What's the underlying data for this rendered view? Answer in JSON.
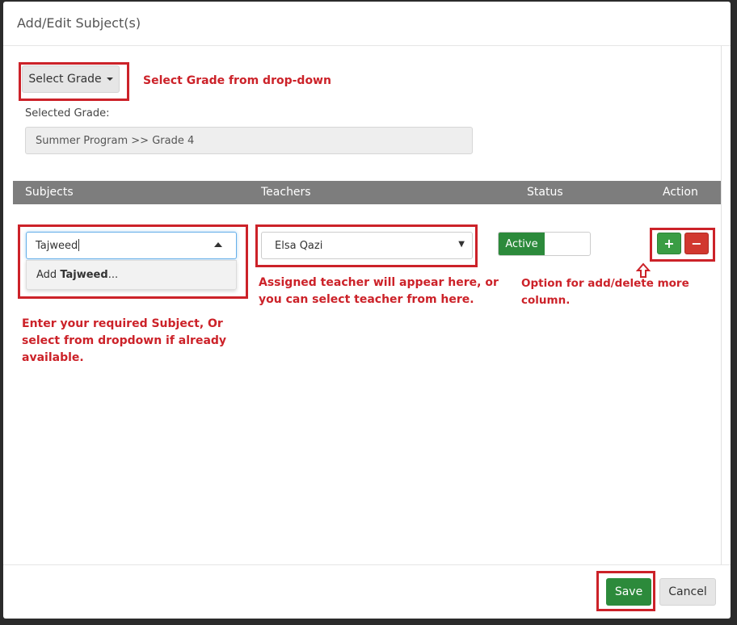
{
  "dialog": {
    "title": "Add/Edit Subject(s)"
  },
  "grade": {
    "button_label": "Select Grade",
    "selected_label": "Selected Grade:",
    "selected_value": "Summer Program >> Grade 4"
  },
  "table": {
    "headers": [
      "Subjects",
      "Teachers",
      "Status",
      "Action"
    ],
    "row": {
      "subject_value": "Tajweed",
      "suggestion_prefix": "Add ",
      "suggestion_term": "Tajweed",
      "suggestion_suffix": "...",
      "teacher_value": "Elsa Qazi",
      "status_label": "Active",
      "add_symbol": "+",
      "remove_symbol": "−"
    }
  },
  "annotations": {
    "grade": "Select Grade from drop-down",
    "teacher_line1": "Assigned teacher will appear here, or",
    "teacher_line2": "you can select teacher from here.",
    "action": "Option for add/delete more column.",
    "subject_line1": "Enter your required Subject, Or",
    "subject_line2": "select from dropdown if already",
    "subject_line3": "available."
  },
  "footer": {
    "save_label": "Save",
    "cancel_label": "Cancel"
  },
  "colors": {
    "annotation": "#cc2229",
    "success": "#2c8a3b",
    "danger": "#d1382f",
    "table_header": "#7d7d7d"
  }
}
